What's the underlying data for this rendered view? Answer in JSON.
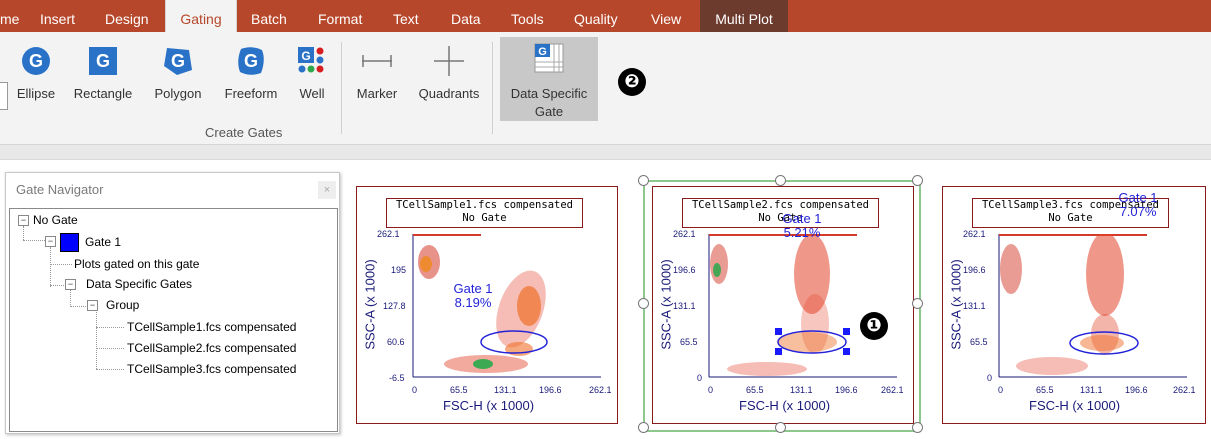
{
  "tabs": [
    "me",
    "Insert",
    "Design",
    "Gating",
    "Batch",
    "Format",
    "Text",
    "Data",
    "Tools",
    "Quality",
    "View",
    "Multi Plot"
  ],
  "ribbon": {
    "buttons": [
      "Ellipse",
      "Rectangle",
      "Polygon",
      "Freeform",
      "Well",
      "Marker",
      "Quadrants"
    ],
    "data_specific_gate": [
      "Data Specific",
      "Gate"
    ],
    "group_label": "Create Gates"
  },
  "badges": [
    "❷",
    "❶"
  ],
  "navigator": {
    "title": "Gate Navigator",
    "close": "×",
    "tree": [
      "No Gate",
      "Gate 1",
      "Plots gated on this gate",
      "Data Specific Gates",
      "Group",
      "TCellSample1.fcs compensated",
      "TCellSample2.fcs compensated",
      "TCellSample3.fcs compensated"
    ]
  },
  "plots": [
    {
      "title": [
        "TCellSample1.fcs compensated",
        "No Gate"
      ],
      "gate_label": [
        "Gate 1",
        "8.19%"
      ],
      "x_ticks": [
        "0",
        "65.5",
        "131.1",
        "196.6",
        "262.1"
      ],
      "y_ticks": [
        "262.1",
        "195",
        "127.8",
        "60.6",
        "-6.5"
      ],
      "xlabel": "FSC-H (x 1000)",
      "ylabel": "SSC-A (x 1000)"
    },
    {
      "title": [
        "TCellSample2.fcs compensated",
        "No Gate"
      ],
      "gate_label": [
        "Gate 1",
        "5.21%"
      ],
      "x_ticks": [
        "0",
        "65.5",
        "131.1",
        "196.6",
        "262.1"
      ],
      "y_ticks": [
        "262.1",
        "196.6",
        "131.1",
        "65.5",
        "0"
      ],
      "xlabel": "FSC-H (x 1000)",
      "ylabel": "SSC-A (x 1000)"
    },
    {
      "title": [
        "TCellSample3.fcs compensated",
        "No Gate"
      ],
      "gate_label": [
        "Gate 1",
        "7.07%"
      ],
      "x_ticks": [
        "0",
        "65.5",
        "131.1",
        "196.6",
        "262.1"
      ],
      "y_ticks": [
        "262.1",
        "196.6",
        "131.1",
        "65.5",
        "0"
      ],
      "xlabel": "FSC-H (x 1000)",
      "ylabel": "SSC-A (x 1000)"
    }
  ],
  "colors": {
    "tab_bar": "#b7472a",
    "gate_blue": "#2323d8",
    "plot_border": "#8b1a1a",
    "selection_green": "#8cc78c"
  }
}
